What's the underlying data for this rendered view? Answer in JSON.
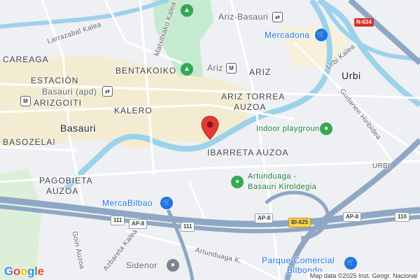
{
  "colors": {
    "water": "#9cd2ea",
    "motorway": "#8ea7c4",
    "park": "#c4ead0",
    "urban": "#f4ecd2",
    "marker": "#e53935",
    "poi_blue": "#1a73e8",
    "poi_green": "#34a853"
  },
  "districts": {
    "careaga": "CAREAGA",
    "estacion": "ESTACIÓN",
    "bentakoiko": "BENTAKOIKO",
    "ariz": "ARIZ",
    "ariz_torrea_1": "ARIZ TORREA",
    "ariz_torrea_2": "AUZOA",
    "kalero": "KALERO",
    "arizgoiti": "ARIZGOITI",
    "basozelai": "BASOZELAI",
    "ibarreta": "IBARRETA AUZOA",
    "pagobieta_1": "PAGOBIETA",
    "pagobieta_2": "AUZOA",
    "urbi_small": "URBI"
  },
  "towns": {
    "basauri": "Basauri",
    "urbi": "Urbi"
  },
  "streets": {
    "larrazabal": "Larrazabal Kalea",
    "matxitxako": "Matxitxako Kalea",
    "urbi_kalea": "Urbi Kalea",
    "gudarien": "Gudarien Hiribidea",
    "goiri": "Goiri Auzoa",
    "azbarren": "Azbareta Kalea",
    "artunduaga_k": "Artunduaga K."
  },
  "stations": {
    "ariz_basauri": "Ariz-Basauri",
    "ariz": "Ariz",
    "basauri_apd": "Basauri (apd)",
    "metro_glyph": "M",
    "rail_glyph": "⇄"
  },
  "pois": {
    "mercadona": "Mercadona",
    "indoor_playground": "Indoor playground",
    "artunduaga_1": "Artunduaga -",
    "artunduaga_2": "Basauri Kiroldegia",
    "mercabilbao": "MercaBilbao",
    "sidenor": "Sidenor",
    "parque_1": "Parque Comercial",
    "parque_2": "Bilbondo"
  },
  "road_shields": {
    "n634": "N-634",
    "ap8_a": "AP-8",
    "ap8_b": "AP-8",
    "ap8_c": "AP-8",
    "r111_a": "111",
    "r111_b": "111",
    "bi625": "BI-625",
    "r110": "110"
  },
  "icons": {
    "tree": "tree-icon",
    "shopping": "shopping-cart-icon",
    "bag": "shopping-bag-icon",
    "park": "park-icon",
    "factory": "factory-icon"
  },
  "footer": {
    "logo": [
      "G",
      "o",
      "o",
      "g",
      "l",
      "e"
    ],
    "attribution": "Map data ©2025 Inst. Geogr. Nacional"
  }
}
